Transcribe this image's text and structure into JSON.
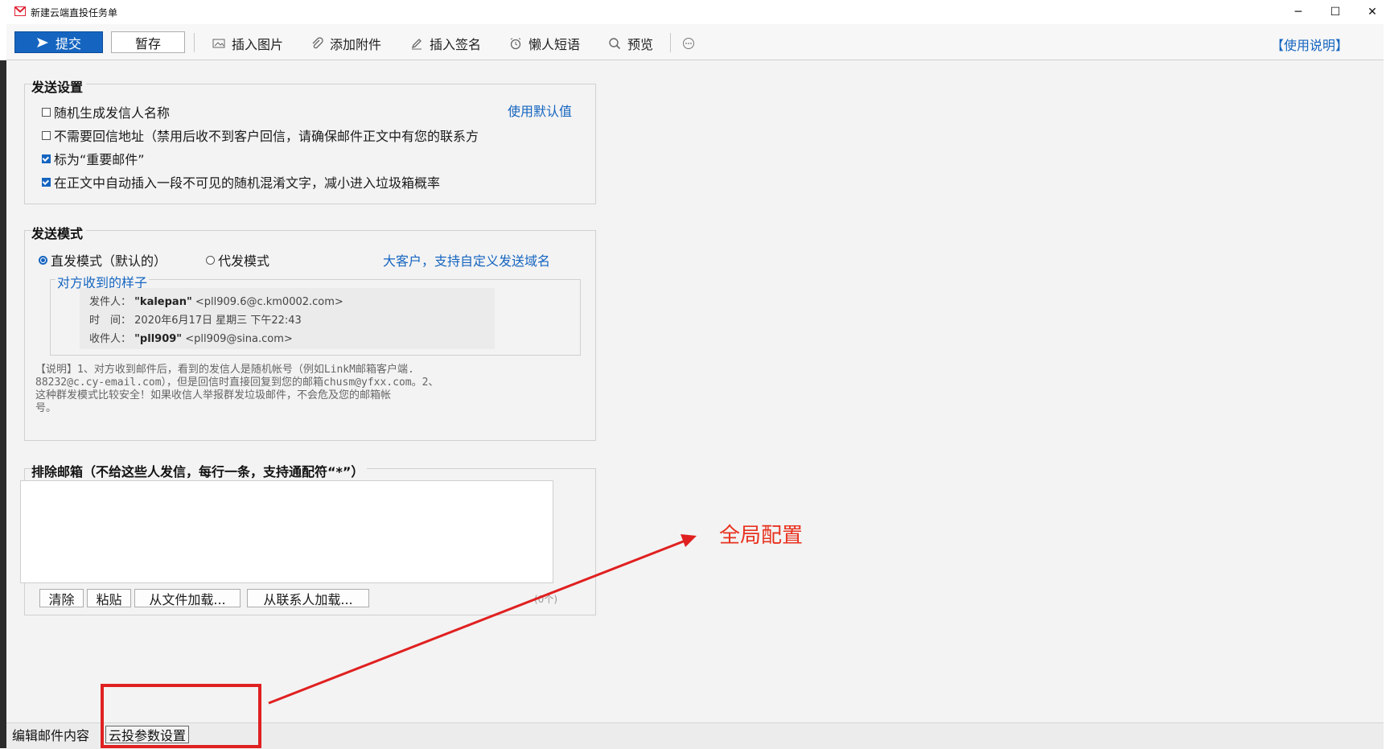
{
  "window": {
    "title": "新建云端直投任务单",
    "controls": {
      "minimize": "─",
      "maximize": "☐",
      "close": "✕"
    }
  },
  "toolbar": {
    "submit_label": "提交",
    "save_label": "暂存",
    "insert_image_label": "插入图片",
    "add_attachment_label": "添加附件",
    "insert_signature_label": "插入签名",
    "quick_phrases_label": "懒人短语",
    "preview_label": "预览",
    "more_icon": "more-circle-icon",
    "help_label": "【使用说明】"
  },
  "send_settings": {
    "title": "发送设置",
    "use_default_link": "使用默认值",
    "options": [
      {
        "label": "随机生成发信人名称",
        "checked": false
      },
      {
        "label": "不需要回信地址（禁用后收不到客户回信，请确保邮件正文中有您的联系方",
        "checked": false
      },
      {
        "label": "标为“重要邮件”",
        "checked": true
      },
      {
        "label": "在正文中自动插入一段不可见的随机混淆文字，减小进入垃圾箱概率",
        "checked": true
      }
    ]
  },
  "send_mode": {
    "title": "发送模式",
    "mode_direct": "直发模式（默认的）",
    "mode_proxy": "代发模式",
    "selected": "direct",
    "custom_domain_link": "大客户，支持自定义发送域名",
    "sample_title": "对方收到的样子",
    "sample": {
      "from_label": "发件人：",
      "from_name": "\"kalepan\"",
      "from_addr": "<pll909.6@c.km0002.com>",
      "time_label": "时　间：",
      "time_value": "2020年6月17日 星期三 下午22:43",
      "to_label": "收件人：",
      "to_name": "\"pll909\"",
      "to_addr": "<pll909@sina.com>"
    },
    "note_lines": [
      "【说明】1、对方收到邮件后，看到的发信人是随机帐号（例如LinkM邮箱客户端.",
      "88232@c.cy-email.com），但是回信时直接回复到您的邮箱chusm@yfxx.com。2、",
      "这种群发模式比较安全！如果收信人举报群发垃圾邮件，不会危及您的邮箱帐",
      "号。"
    ]
  },
  "exclude": {
    "title": "排除邮箱（不给这些人发信，每行一条，支持通配符“*”）",
    "textarea_value": "",
    "buttons": {
      "clear": "清除",
      "paste": "粘贴",
      "load_file": "从文件加载...",
      "load_contacts": "从联系人加载..."
    },
    "count": "(0个)"
  },
  "tabs": {
    "edit_content": "编辑邮件内容",
    "cloud_params": "云投参数设置"
  },
  "annotation": {
    "text": "全局配置",
    "color": "#e8321f"
  },
  "colors": {
    "accent": "#1565c0",
    "annotation_red": "#e02020"
  }
}
